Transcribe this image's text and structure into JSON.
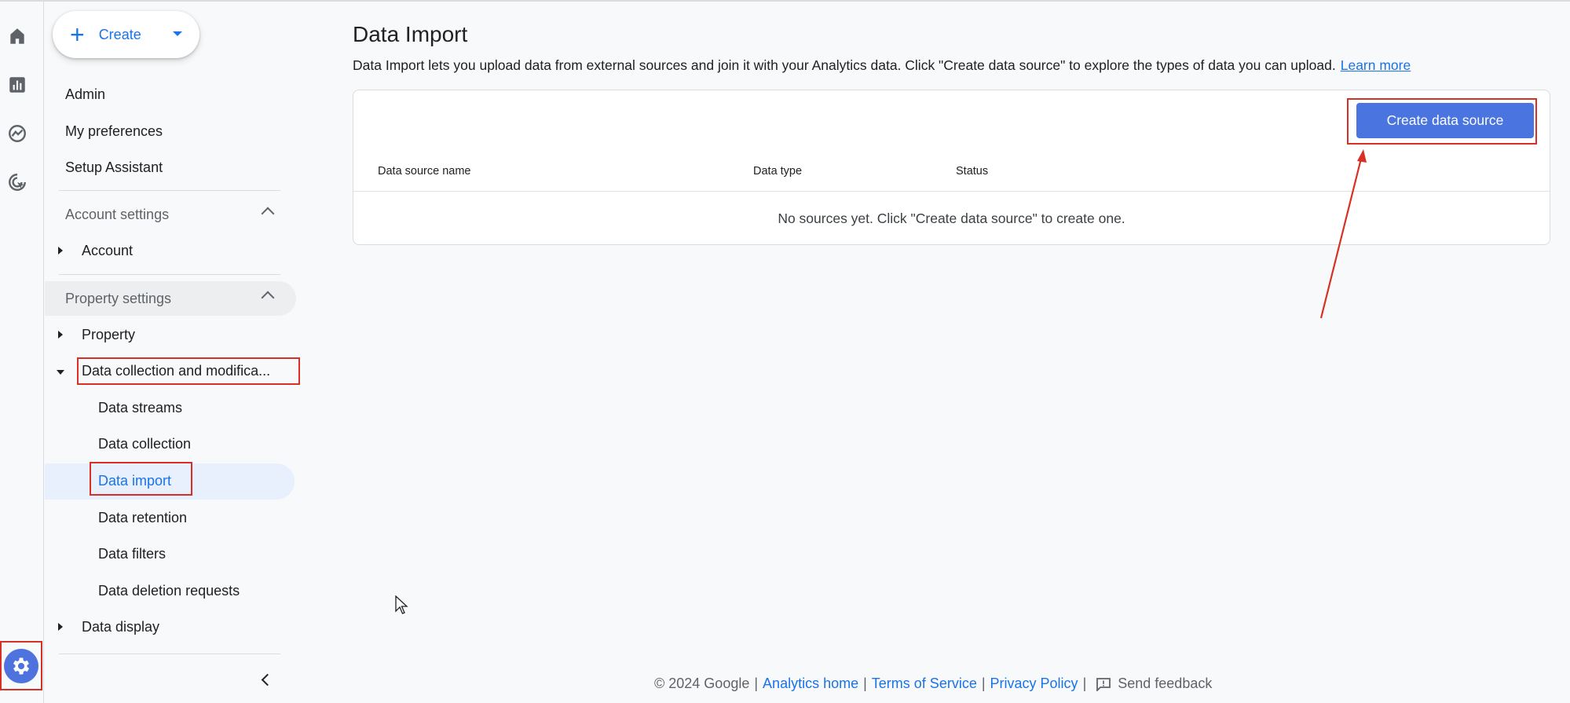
{
  "nav_rail": {
    "icons": [
      "home-icon",
      "reports-icon",
      "explore-icon",
      "advertising-icon"
    ],
    "admin_icon": "gear-icon"
  },
  "sidebar": {
    "create_label": "Create",
    "top_items": [
      "Admin",
      "My preferences",
      "Setup Assistant"
    ],
    "account_settings": {
      "header": "Account settings",
      "items": [
        "Account"
      ]
    },
    "property_settings": {
      "header": "Property settings",
      "items": {
        "property": "Property",
        "data_collection": "Data collection and modifica...",
        "data_display": "Data display"
      },
      "sub_items": [
        "Data streams",
        "Data collection",
        "Data import",
        "Data retention",
        "Data filters",
        "Data deletion requests"
      ],
      "selected": "Data import"
    }
  },
  "main": {
    "title": "Data Import",
    "description": "Data Import lets you upload data from external sources and join it with your Analytics data. Click \"Create data source\" to explore the types of data you can upload.",
    "learn_more": "Learn more",
    "create_button": "Create data source",
    "columns": [
      "Data source name",
      "Data type",
      "Status"
    ],
    "empty_message": "No sources yet. Click \"Create data source\" to create one."
  },
  "footer": {
    "copyright": "© 2024 Google",
    "links": [
      "Analytics home",
      "Terms of Service",
      "Privacy Policy"
    ],
    "feedback": "Send feedback"
  },
  "colors": {
    "accent": "#1a73e8",
    "button": "#4a74df",
    "annotation": "#d93025",
    "selected_bg": "#e8f0fe"
  }
}
